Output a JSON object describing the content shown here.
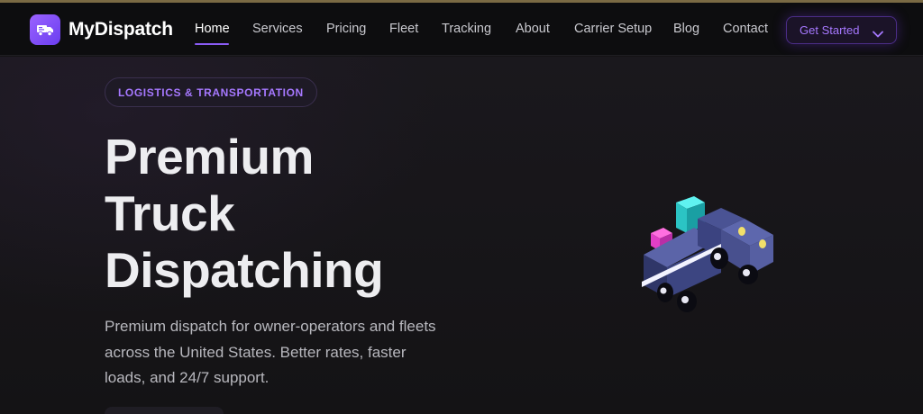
{
  "brand": {
    "name": "MyDispatch",
    "logo_icon": "truck-icon",
    "accent": "#8b5cf6"
  },
  "nav": {
    "items": [
      {
        "label": "Home",
        "active": true
      },
      {
        "label": "Services"
      },
      {
        "label": "Pricing"
      },
      {
        "label": "Fleet"
      },
      {
        "label": "Tracking"
      },
      {
        "label": "About"
      },
      {
        "label": "Carrier Setup"
      },
      {
        "label": "Blog"
      },
      {
        "label": "Contact"
      }
    ],
    "cta": {
      "label": "Get Started",
      "icon": "chevron-down-icon"
    }
  },
  "hero": {
    "eyebrow": "LOGISTICS & TRANSPORTATION",
    "headline": [
      "Premium",
      "Truck",
      "Dispatching"
    ],
    "subtext": "Premium dispatch for owner-operators and fleets across the United States. Better rates, faster loads, and 24/7 support.",
    "illustration": "isometric-truck-illustration"
  }
}
